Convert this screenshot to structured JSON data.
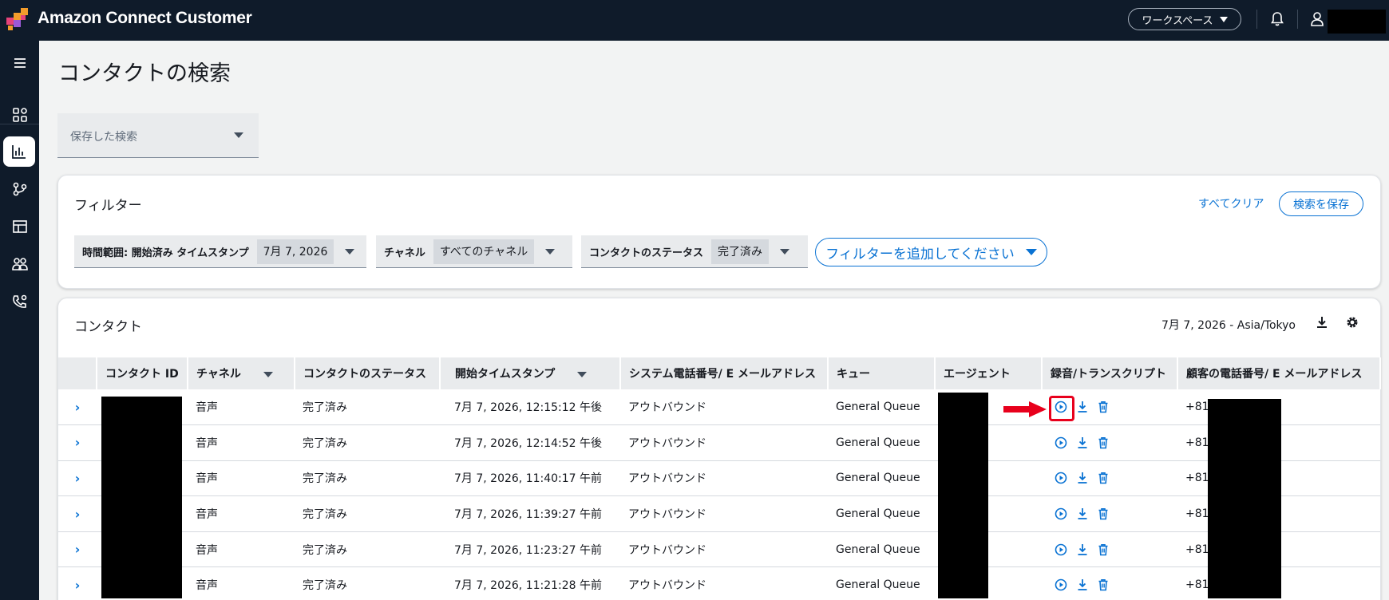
{
  "app": {
    "title": "Amazon Connect Customer"
  },
  "topbar": {
    "workspace_label": "ワークスペース"
  },
  "page": {
    "title": "コンタクトの検索"
  },
  "saved_search": {
    "placeholder": "保存した検索"
  },
  "filters": {
    "title": "フィルター",
    "clear_all": "すべてクリア",
    "save_search": "検索を保存",
    "chips": [
      {
        "label": "時間範囲: 開始済み タイムスタンプ",
        "value": "7月 7, 2026"
      },
      {
        "label": "チャネル",
        "value": "すべてのチャネル"
      },
      {
        "label": "コンタクトのステータス",
        "value": "完了済み"
      }
    ],
    "add_filter": "フィルターを追加してください"
  },
  "contacts": {
    "title": "コンタクト",
    "timezone_label": "7月 7, 2026 - Asia/Tokyo",
    "columns": [
      "",
      "コンタクト ID",
      "チャネル",
      "コンタクトのステータス",
      "開始タイムスタンプ",
      "システム電話番号/ E メールアドレス",
      "キュー",
      "エージェント",
      "録音/トランスクリプト",
      "顧客の電話番号/ E メールアドレス"
    ],
    "rows": [
      {
        "channel": "音声",
        "status": "完了済み",
        "start": "7月 7, 2026, 12:15:12 午後",
        "system": "アウトバウンド",
        "queue": "General Queue",
        "customer": "+81"
      },
      {
        "channel": "音声",
        "status": "完了済み",
        "start": "7月 7, 2026, 12:14:52 午後",
        "system": "アウトバウンド",
        "queue": "General Queue",
        "customer": "+81"
      },
      {
        "channel": "音声",
        "status": "完了済み",
        "start": "7月 7, 2026, 11:40:17 午前",
        "system": "アウトバウンド",
        "queue": "General Queue",
        "customer": "+81"
      },
      {
        "channel": "音声",
        "status": "完了済み",
        "start": "7月 7, 2026, 11:39:27 午前",
        "system": "アウトバウンド",
        "queue": "General Queue",
        "customer": "+81"
      },
      {
        "channel": "音声",
        "status": "完了済み",
        "start": "7月 7, 2026, 11:23:27 午前",
        "system": "アウトバウンド",
        "queue": "General Queue",
        "customer": "+81"
      },
      {
        "channel": "音声",
        "status": "完了済み",
        "start": "7月 7, 2026, 11:21:28 午前",
        "system": "アウトバウンド",
        "queue": "General Queue",
        "customer": "+81"
      }
    ]
  },
  "colors": {
    "nav_bg": "#0f1b2a",
    "link": "#0972d3",
    "highlight": "#e8001c"
  }
}
